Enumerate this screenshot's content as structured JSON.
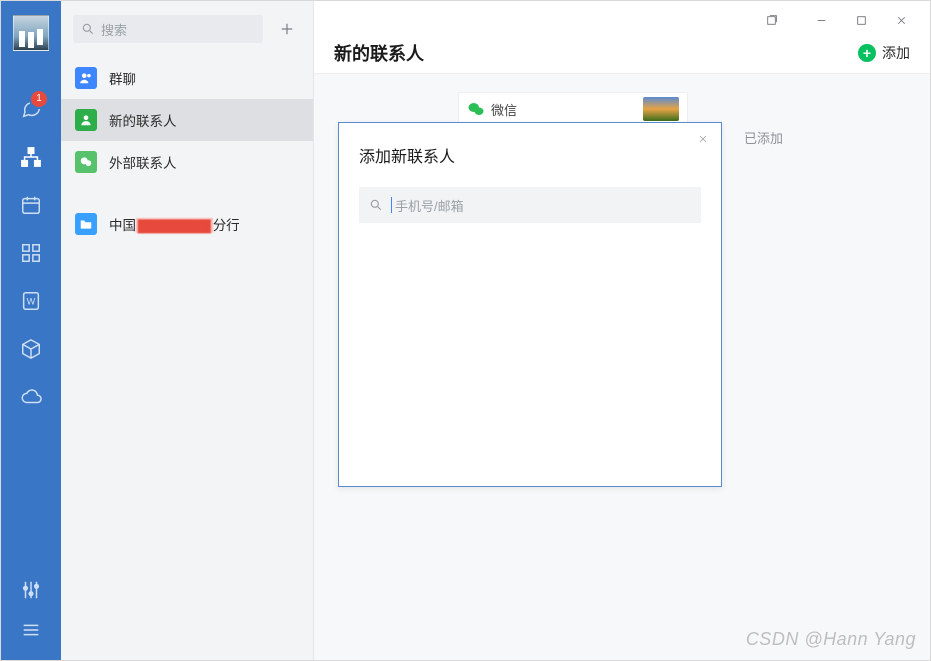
{
  "rail": {
    "chat_badge": "1"
  },
  "sidebar": {
    "search_placeholder": "搜索",
    "items": [
      {
        "label": "群聊"
      },
      {
        "label": "新的联系人"
      },
      {
        "label": "外部联系人"
      }
    ],
    "folder": {
      "prefix": "中国",
      "redacted": "▇▇▇▇▇▇▇",
      "suffix": "分行"
    }
  },
  "header": {
    "title": "新的联系人",
    "add_label": "添加"
  },
  "card": {
    "name": "微信"
  },
  "status": "已添加",
  "dialog": {
    "title": "添加新联系人",
    "placeholder": "手机号/邮箱"
  },
  "watermark": "CSDN @Hann Yang"
}
